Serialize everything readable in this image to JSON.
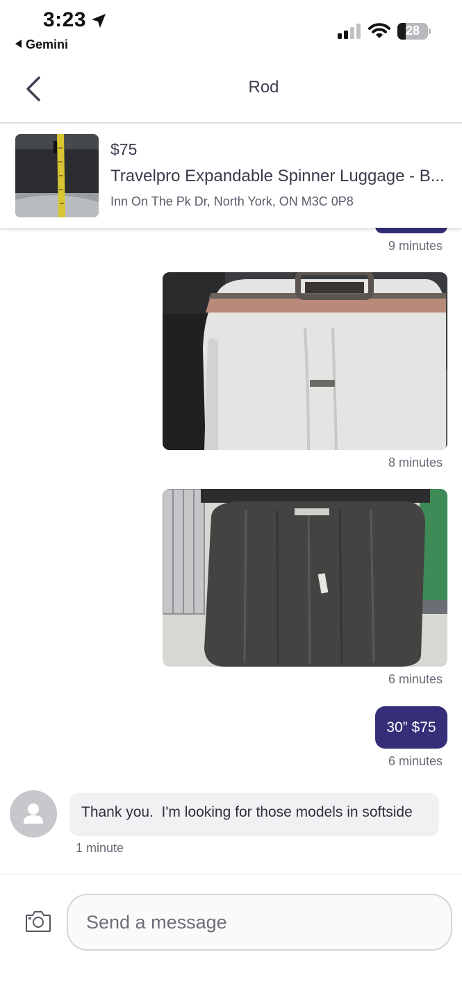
{
  "status_bar": {
    "time": "3:23",
    "back_app": "Gemini",
    "battery": "28",
    "battery_level": 0.28
  },
  "header": {
    "contact_name": "Rod"
  },
  "listing": {
    "price": "$75",
    "title": "Travelpro Expandable Spinner Luggage - B...",
    "address": "Inn On The Pk Dr, North York, ON M3C 0P8"
  },
  "messages": [
    {
      "type": "sent",
      "time": "9 minutes"
    },
    {
      "type": "photo",
      "time": "8 minutes"
    },
    {
      "type": "photo",
      "time": "6 minutes"
    },
    {
      "type": "sent",
      "text": "30” $75",
      "time": "6 minutes"
    },
    {
      "type": "received",
      "text": "Thank you.  I'm looking for those models in softside",
      "time": "1 minute"
    }
  ],
  "composer": {
    "placeholder": "Send a message"
  },
  "colors": {
    "accent": "#352f7a",
    "received_bubble": "#f1f1f4",
    "text": "#3a3a4a"
  },
  "icons": [
    "location-arrow-icon",
    "signal-icon",
    "wifi-icon",
    "battery-icon",
    "back-chevron-icon",
    "camera-icon",
    "avatar-person-icon"
  ]
}
